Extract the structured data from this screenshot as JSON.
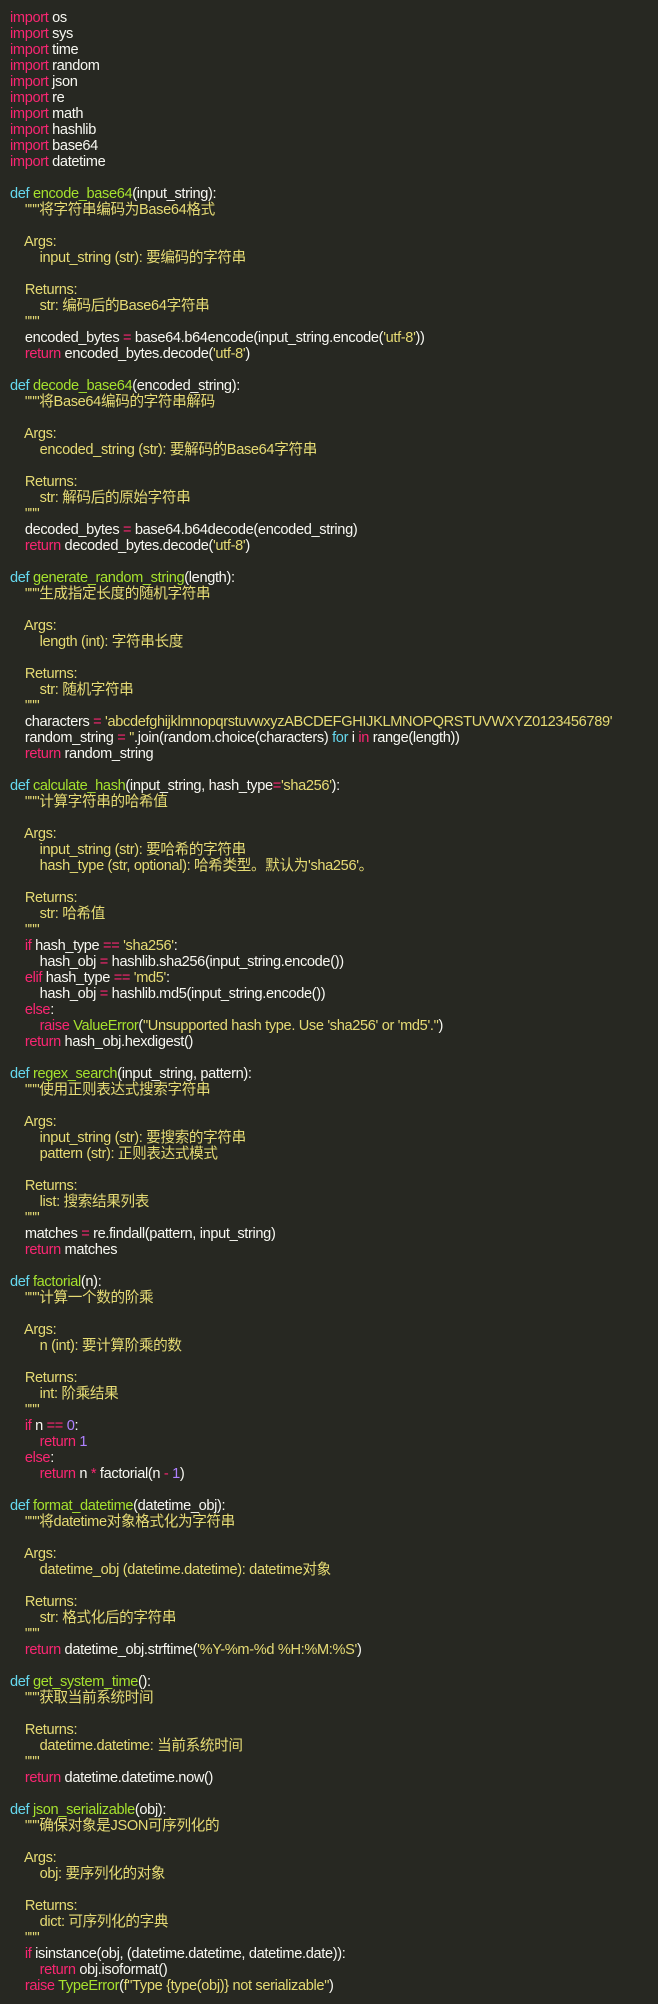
{
  "editor": {
    "theme_colors": {
      "background": "#272822",
      "text": "#f8f8f2",
      "keyword": "#f92672",
      "def": "#66d9ef",
      "function": "#a6e22e",
      "string": "#e6db74",
      "number": "#ae81ff"
    },
    "lines": [
      [
        [
          "kw",
          "import"
        ],
        [
          "txt",
          " os"
        ]
      ],
      [
        [
          "kw",
          "import"
        ],
        [
          "txt",
          " sys"
        ]
      ],
      [
        [
          "kw",
          "import"
        ],
        [
          "txt",
          " time"
        ]
      ],
      [
        [
          "kw",
          "import"
        ],
        [
          "txt",
          " random"
        ]
      ],
      [
        [
          "kw",
          "import"
        ],
        [
          "txt",
          " json"
        ]
      ],
      [
        [
          "kw",
          "import"
        ],
        [
          "txt",
          " re"
        ]
      ],
      [
        [
          "kw",
          "import"
        ],
        [
          "txt",
          " math"
        ]
      ],
      [
        [
          "kw",
          "import"
        ],
        [
          "txt",
          " hashlib"
        ]
      ],
      [
        [
          "kw",
          "import"
        ],
        [
          "txt",
          " base64"
        ]
      ],
      [
        [
          "kw",
          "import"
        ],
        [
          "txt",
          " datetime"
        ]
      ],
      [],
      [
        [
          "def",
          "def "
        ],
        [
          "fn",
          "encode_base64"
        ],
        [
          "txt",
          "(input_string):"
        ]
      ],
      [
        [
          "str",
          "    \"\"\"将字符串编码为Base64格式"
        ]
      ],
      [],
      [
        [
          "str",
          "    Args:"
        ]
      ],
      [
        [
          "str",
          "        input_string (str): 要编码的字符串"
        ]
      ],
      [],
      [
        [
          "str",
          "    Returns:"
        ]
      ],
      [
        [
          "str",
          "        str: 编码后的Base64字符串"
        ]
      ],
      [
        [
          "str",
          "    \"\"\""
        ]
      ],
      [
        [
          "txt",
          "    encoded_bytes "
        ],
        [
          "op",
          "="
        ],
        [
          "txt",
          " base64.b64encode(input_string.encode("
        ],
        [
          "str",
          "'utf-8'"
        ],
        [
          "txt",
          "))"
        ]
      ],
      [
        [
          "kw",
          "    return"
        ],
        [
          "txt",
          " encoded_bytes.decode("
        ],
        [
          "str",
          "'utf-8'"
        ],
        [
          "txt",
          ")"
        ]
      ],
      [],
      [
        [
          "def",
          "def "
        ],
        [
          "fn",
          "decode_base64"
        ],
        [
          "txt",
          "(encoded_string):"
        ]
      ],
      [
        [
          "str",
          "    \"\"\"将Base64编码的字符串解码"
        ]
      ],
      [],
      [
        [
          "str",
          "    Args:"
        ]
      ],
      [
        [
          "str",
          "        encoded_string (str): 要解码的Base64字符串"
        ]
      ],
      [],
      [
        [
          "str",
          "    Returns:"
        ]
      ],
      [
        [
          "str",
          "        str: 解码后的原始字符串"
        ]
      ],
      [
        [
          "str",
          "    \"\"\""
        ]
      ],
      [
        [
          "txt",
          "    decoded_bytes "
        ],
        [
          "op",
          "="
        ],
        [
          "txt",
          " base64.b64decode(encoded_string)"
        ]
      ],
      [
        [
          "kw",
          "    return"
        ],
        [
          "txt",
          " decoded_bytes.decode("
        ],
        [
          "str",
          "'utf-8'"
        ],
        [
          "txt",
          ")"
        ]
      ],
      [],
      [
        [
          "def",
          "def "
        ],
        [
          "fn",
          "generate_random_string"
        ],
        [
          "txt",
          "(length):"
        ]
      ],
      [
        [
          "str",
          "    \"\"\"生成指定长度的随机字符串"
        ]
      ],
      [],
      [
        [
          "str",
          "    Args:"
        ]
      ],
      [
        [
          "str",
          "        length (int): 字符串长度"
        ]
      ],
      [],
      [
        [
          "str",
          "    Returns:"
        ]
      ],
      [
        [
          "str",
          "        str: 随机字符串"
        ]
      ],
      [
        [
          "str",
          "    \"\"\""
        ]
      ],
      [
        [
          "txt",
          "    characters "
        ],
        [
          "op",
          "="
        ],
        [
          "str",
          " 'abcdefghijklmnopqrstuvwxyzABCDEFGHIJKLMNOPQRSTUVWXYZ0123456789'"
        ]
      ],
      [
        [
          "txt",
          "    random_string "
        ],
        [
          "op",
          "="
        ],
        [
          "str",
          " ''"
        ],
        [
          "txt",
          ".join(random.choice(characters) "
        ],
        [
          "def",
          "for"
        ],
        [
          "txt",
          " i "
        ],
        [
          "kw",
          "in"
        ],
        [
          "txt",
          " range(length))"
        ]
      ],
      [
        [
          "kw",
          "    return"
        ],
        [
          "txt",
          " random_string"
        ]
      ],
      [],
      [
        [
          "def",
          "def "
        ],
        [
          "fn",
          "calculate_hash"
        ],
        [
          "txt",
          "(input_string, hash_type"
        ],
        [
          "op",
          "="
        ],
        [
          "str",
          "'sha256'"
        ],
        [
          "txt",
          "):"
        ]
      ],
      [
        [
          "str",
          "    \"\"\"计算字符串的哈希值"
        ]
      ],
      [],
      [
        [
          "str",
          "    Args:"
        ]
      ],
      [
        [
          "str",
          "        input_string (str): 要哈希的字符串"
        ]
      ],
      [
        [
          "str",
          "        hash_type (str, optional): 哈希类型。默认为'sha256'。"
        ]
      ],
      [],
      [
        [
          "str",
          "    Returns:"
        ]
      ],
      [
        [
          "str",
          "        str: 哈希值"
        ]
      ],
      [
        [
          "str",
          "    \"\"\""
        ]
      ],
      [
        [
          "kw",
          "    if"
        ],
        [
          "txt",
          " hash_type "
        ],
        [
          "op",
          "=="
        ],
        [
          "str",
          " 'sha256'"
        ],
        [
          "txt",
          ":"
        ]
      ],
      [
        [
          "txt",
          "        hash_obj "
        ],
        [
          "op",
          "="
        ],
        [
          "txt",
          " hashlib.sha256(input_string.encode())"
        ]
      ],
      [
        [
          "kw",
          "    elif"
        ],
        [
          "txt",
          " hash_type "
        ],
        [
          "op",
          "=="
        ],
        [
          "str",
          " 'md5'"
        ],
        [
          "txt",
          ":"
        ]
      ],
      [
        [
          "txt",
          "        hash_obj "
        ],
        [
          "op",
          "="
        ],
        [
          "txt",
          " hashlib.md5(input_string.encode())"
        ]
      ],
      [
        [
          "kw",
          "    else"
        ],
        [
          "txt",
          ":"
        ]
      ],
      [
        [
          "kw",
          "        raise"
        ],
        [
          "txt",
          " "
        ],
        [
          "cls",
          "ValueError"
        ],
        [
          "txt",
          "("
        ],
        [
          "str",
          "\"Unsupported hash type. Use 'sha256' or 'md5'.\""
        ],
        [
          "txt",
          ")"
        ]
      ],
      [
        [
          "kw",
          "    return"
        ],
        [
          "txt",
          " hash_obj.hexdigest()"
        ]
      ],
      [],
      [
        [
          "def",
          "def "
        ],
        [
          "fn",
          "regex_search"
        ],
        [
          "txt",
          "(input_string, pattern):"
        ]
      ],
      [
        [
          "str",
          "    \"\"\"使用正则表达式搜索字符串"
        ]
      ],
      [],
      [
        [
          "str",
          "    Args:"
        ]
      ],
      [
        [
          "str",
          "        input_string (str): 要搜索的字符串"
        ]
      ],
      [
        [
          "str",
          "        pattern (str): 正则表达式模式"
        ]
      ],
      [],
      [
        [
          "str",
          "    Returns:"
        ]
      ],
      [
        [
          "str",
          "        list: 搜索结果列表"
        ]
      ],
      [
        [
          "str",
          "    \"\"\""
        ]
      ],
      [
        [
          "txt",
          "    matches "
        ],
        [
          "op",
          "="
        ],
        [
          "txt",
          " re.findall(pattern, input_string)"
        ]
      ],
      [
        [
          "kw",
          "    return"
        ],
        [
          "txt",
          " matches"
        ]
      ],
      [],
      [
        [
          "def",
          "def "
        ],
        [
          "fn",
          "factorial"
        ],
        [
          "txt",
          "(n):"
        ]
      ],
      [
        [
          "str",
          "    \"\"\"计算一个数的阶乘"
        ]
      ],
      [],
      [
        [
          "str",
          "    Args:"
        ]
      ],
      [
        [
          "str",
          "        n (int): 要计算阶乘的数"
        ]
      ],
      [],
      [
        [
          "str",
          "    Returns:"
        ]
      ],
      [
        [
          "str",
          "        int: 阶乘结果"
        ]
      ],
      [
        [
          "str",
          "    \"\"\""
        ]
      ],
      [
        [
          "kw",
          "    if"
        ],
        [
          "txt",
          " n "
        ],
        [
          "op",
          "=="
        ],
        [
          "txt",
          " "
        ],
        [
          "num",
          "0"
        ],
        [
          "txt",
          ":"
        ]
      ],
      [
        [
          "kw",
          "        return"
        ],
        [
          "txt",
          " "
        ],
        [
          "num",
          "1"
        ]
      ],
      [
        [
          "kw",
          "    else"
        ],
        [
          "txt",
          ":"
        ]
      ],
      [
        [
          "kw",
          "        return"
        ],
        [
          "txt",
          " n "
        ],
        [
          "op",
          "*"
        ],
        [
          "txt",
          " factorial(n "
        ],
        [
          "op",
          "-"
        ],
        [
          "txt",
          " "
        ],
        [
          "num",
          "1"
        ],
        [
          "txt",
          ")"
        ]
      ],
      [],
      [
        [
          "def",
          "def "
        ],
        [
          "fn",
          "format_datetime"
        ],
        [
          "txt",
          "(datetime_obj):"
        ]
      ],
      [
        [
          "str",
          "    \"\"\"将datetime对象格式化为字符串"
        ]
      ],
      [],
      [
        [
          "str",
          "    Args:"
        ]
      ],
      [
        [
          "str",
          "        datetime_obj (datetime.datetime): datetime对象"
        ]
      ],
      [],
      [
        [
          "str",
          "    Returns:"
        ]
      ],
      [
        [
          "str",
          "        str: 格式化后的字符串"
        ]
      ],
      [
        [
          "str",
          "    \"\"\""
        ]
      ],
      [
        [
          "kw",
          "    return"
        ],
        [
          "txt",
          " datetime_obj.strftime("
        ],
        [
          "str",
          "'%Y-%m-%d %H:%M:%S'"
        ],
        [
          "txt",
          ")"
        ]
      ],
      [],
      [
        [
          "def",
          "def "
        ],
        [
          "fn",
          "get_system_time"
        ],
        [
          "txt",
          "():"
        ]
      ],
      [
        [
          "str",
          "    \"\"\"获取当前系统时间"
        ]
      ],
      [],
      [
        [
          "str",
          "    Returns:"
        ]
      ],
      [
        [
          "str",
          "        datetime.datetime: 当前系统时间"
        ]
      ],
      [
        [
          "str",
          "    \"\"\""
        ]
      ],
      [
        [
          "kw",
          "    return"
        ],
        [
          "txt",
          " datetime.datetime.now()"
        ]
      ],
      [],
      [
        [
          "def",
          "def "
        ],
        [
          "fn",
          "json_serializable"
        ],
        [
          "txt",
          "(obj):"
        ]
      ],
      [
        [
          "str",
          "    \"\"\"确保对象是JSON可序列化的"
        ]
      ],
      [],
      [
        [
          "str",
          "    Args:"
        ]
      ],
      [
        [
          "str",
          "        obj: 要序列化的对象"
        ]
      ],
      [],
      [
        [
          "str",
          "    Returns:"
        ]
      ],
      [
        [
          "str",
          "        dict: 可序列化的字典"
        ]
      ],
      [
        [
          "str",
          "    \"\"\""
        ]
      ],
      [
        [
          "kw",
          "    if"
        ],
        [
          "txt",
          " isinstance(obj, (datetime.datetime, datetime.date)):"
        ]
      ],
      [
        [
          "kw",
          "        return"
        ],
        [
          "txt",
          " obj.isoformat()"
        ]
      ],
      [
        [
          "kw",
          "    raise"
        ],
        [
          "txt",
          " "
        ],
        [
          "cls",
          "TypeError"
        ],
        [
          "txt",
          "("
        ],
        [
          "str",
          "f\"Type {type(obj)} not serializable\""
        ],
        [
          "txt",
          ")"
        ]
      ]
    ]
  }
}
